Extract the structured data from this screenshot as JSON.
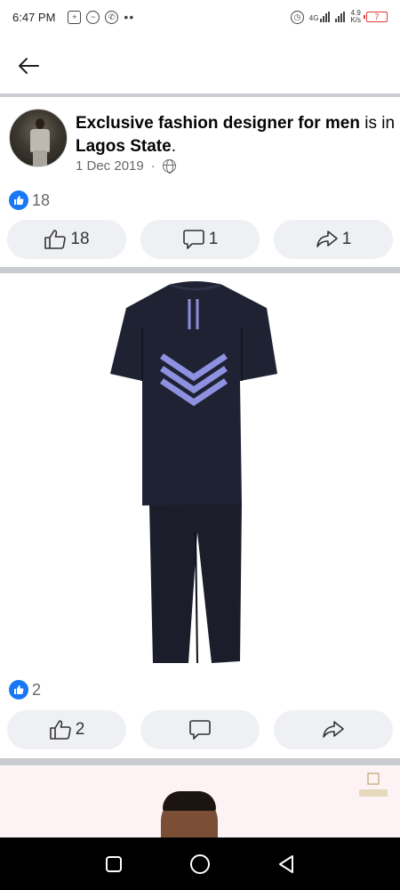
{
  "status_bar": {
    "time": "6:47 PM",
    "network_label": "4G",
    "speed_value": "4.9",
    "speed_unit": "K/s",
    "battery_level": "7",
    "battery_color": "#e53935"
  },
  "header": {
    "back_icon": "arrow-left-icon"
  },
  "post": {
    "author": "Exclusive fashion designer for men",
    "connector": " is in ",
    "location": "Lagos State",
    "end": ".",
    "date": "1 Dec 2019",
    "separator": "·",
    "privacy_icon": "globe-icon",
    "reaction_count": "18",
    "actions": {
      "like_count": "18",
      "comment_count": "1",
      "share_count": "1"
    }
  },
  "photo_post": {
    "reaction_count": "2",
    "actions": {
      "like_count": "2",
      "comment_count": "",
      "share_count": ""
    }
  },
  "colors": {
    "accent": "#1877f2",
    "divider": "#c9ccd1",
    "button_bg": "#eef0f3",
    "meta_text": "#65676b"
  }
}
